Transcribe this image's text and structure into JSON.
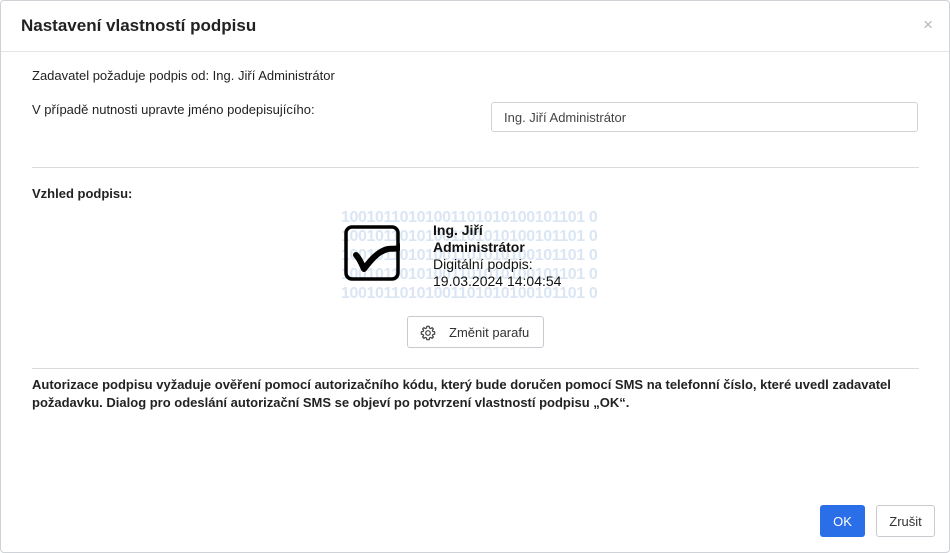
{
  "dialog": {
    "title": "Nastavení vlastností podpisu",
    "close_label": "×"
  },
  "requester": {
    "text": "Zadavatel požaduje podpis od: Ing. Jiří Administrátor"
  },
  "signer": {
    "label": "V případě nutnosti upravte jméno podepisujícího:",
    "value": "Ing. Jiří Administrátor"
  },
  "appearance": {
    "title": "Vzhled podpisu:",
    "binary_lines": [
      "10010110101001101010100101101 0",
      "10010110101001101010100101101 0",
      "10010110101001101010100101101 0",
      "10010110101001101010100101101 0",
      "10010110101001101010100101101 0"
    ],
    "sig_name_line1": "Ing. Jiří",
    "sig_name_line2": "Administrátor",
    "sig_type": "Digitální podpis:",
    "sig_date": "19.03.2024 14:04:54",
    "change_button": "Změnit parafu",
    "change_icon": "gear-icon"
  },
  "info": {
    "text": "Autorizace podpisu vyžaduje ověření pomocí autorizačního kódu, který bude doručen pomocí SMS na telefonní číslo, které uvedl zadavatel požadavku. Dialog pro odeslání autorizační SMS se objeví po potvrzení vlastností podpisu „OK“."
  },
  "footer": {
    "ok_label": "OK",
    "cancel_label": "Zrušit"
  },
  "colors": {
    "primary": "#2b6fe8",
    "binary_watermark": "#dbe6f4"
  }
}
